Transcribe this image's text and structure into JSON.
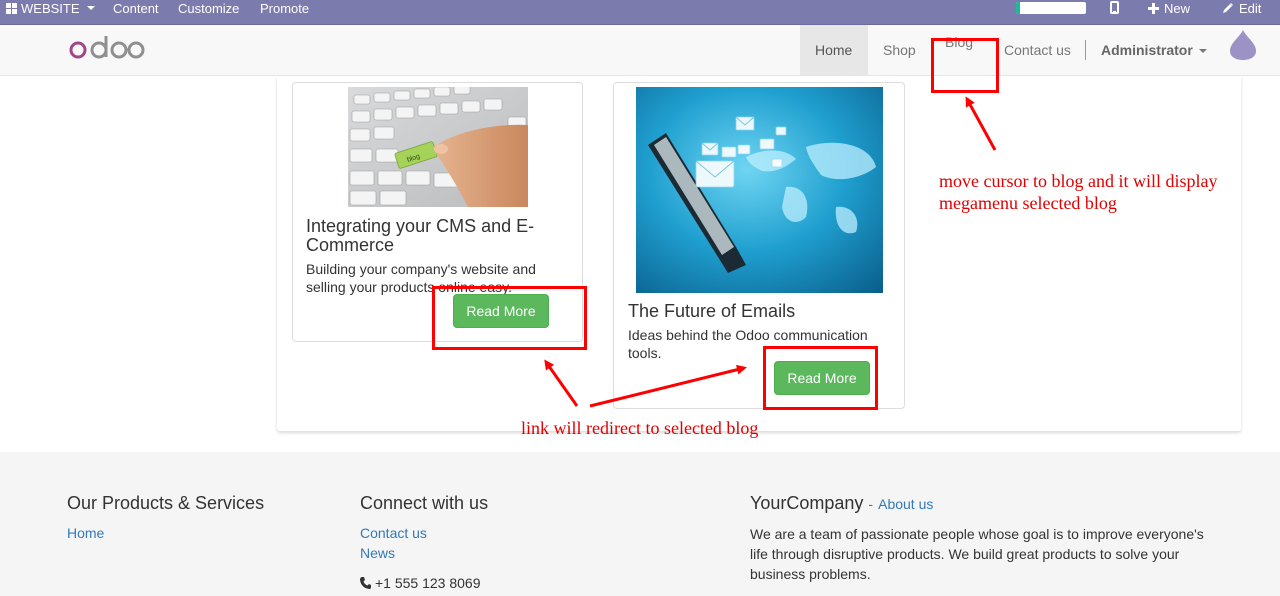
{
  "admin_bar": {
    "website_label": "WEBSITE",
    "content_label": "Content",
    "customize_label": "Customize",
    "promote_label": "Promote",
    "new_label": "New",
    "edit_label": "Edit"
  },
  "navbar": {
    "logo_text": "odoo",
    "items": [
      {
        "label": "Home"
      },
      {
        "label": "Shop"
      },
      {
        "label": "Blog"
      },
      {
        "label": "Contact us"
      }
    ],
    "user_label": "Administrator"
  },
  "blog_cards": [
    {
      "title": "Integrating your CMS and E-Commerce",
      "excerpt": "Building your company's website and selling your products online easy.",
      "button_label": "Read More",
      "image_label": "blog"
    },
    {
      "title": "The Future of Emails",
      "excerpt": "Ideas behind the Odoo communication tools.",
      "button_label": "Read More"
    }
  ],
  "annotations": {
    "blog_note": "move cursor to blog and it will display megamenu selected blog",
    "link_note": "link will redirect to selected blog"
  },
  "footer": {
    "products_heading": "Our Products & Services",
    "products_links": [
      "Home"
    ],
    "connect_heading": "Connect with us",
    "connect_links": [
      "Contact us",
      "News"
    ],
    "phone": "+1 555 123 8069",
    "company_heading": "YourCompany",
    "about_link": "About us",
    "about_separator": "-",
    "company_text": "We are a team of passionate people whose goal is to improve everyone's life through disruptive products. We build great products to solve your business problems."
  },
  "colors": {
    "admin_bar": "#7c7bad",
    "button_green": "#5cb85c",
    "annotation_red": "#ff0000",
    "link_blue": "#337ab7"
  }
}
